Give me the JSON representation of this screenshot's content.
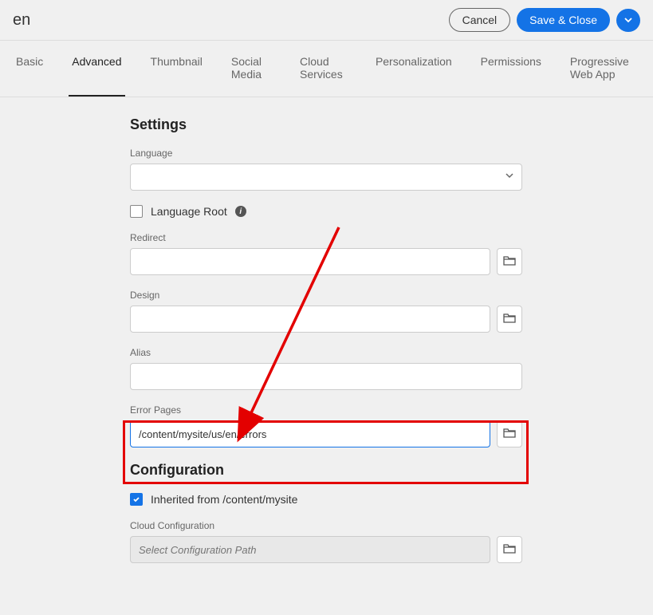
{
  "header": {
    "title": "en",
    "cancel_label": "Cancel",
    "save_label": "Save & Close"
  },
  "tabs": [
    {
      "label": "Basic",
      "active": false
    },
    {
      "label": "Advanced",
      "active": true
    },
    {
      "label": "Thumbnail",
      "active": false
    },
    {
      "label": "Social Media",
      "active": false
    },
    {
      "label": "Cloud Services",
      "active": false
    },
    {
      "label": "Personalization",
      "active": false
    },
    {
      "label": "Permissions",
      "active": false
    },
    {
      "label": "Progressive Web App",
      "active": false
    }
  ],
  "settings": {
    "title": "Settings",
    "language_label": "Language",
    "language_value": "",
    "language_root_label": "Language Root",
    "language_root_checked": false,
    "redirect_label": "Redirect",
    "redirect_value": "",
    "design_label": "Design",
    "design_value": "",
    "alias_label": "Alias",
    "alias_value": "",
    "error_pages_label": "Error Pages",
    "error_pages_value": "/content/mysite/us/en/errors"
  },
  "configuration": {
    "title": "Configuration",
    "inherited_label": "Inherited from /content/mysite",
    "inherited_checked": true,
    "cloud_config_label": "Cloud Configuration",
    "cloud_config_placeholder": "Select Configuration Path"
  }
}
